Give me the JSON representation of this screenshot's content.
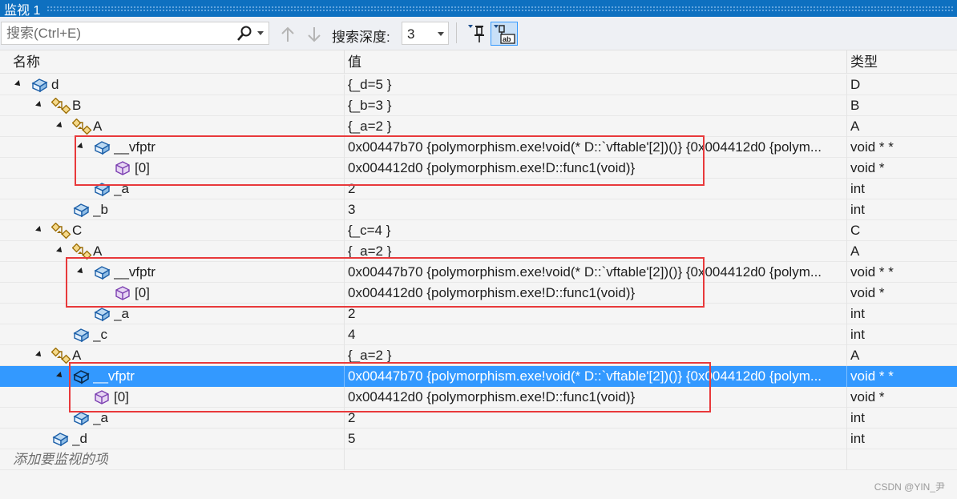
{
  "window": {
    "title": "监视 1"
  },
  "toolbar": {
    "search_placeholder": "搜索(Ctrl+E)",
    "depth_label": "搜索深度:",
    "depth_value": "3"
  },
  "columns": {
    "name": "名称",
    "value": "值",
    "type": "类型"
  },
  "rows": [
    {
      "name": "d",
      "value": "{_d=5 }",
      "type": "D",
      "icon": "object-icon",
      "level": 0,
      "expanded": true
    },
    {
      "name": "B",
      "value": "{_b=3 }",
      "type": "B",
      "icon": "base-class-icon",
      "level": 1,
      "expanded": true
    },
    {
      "name": "A",
      "value": "{_a=2 }",
      "type": "A",
      "icon": "base-class-icon",
      "level": 2,
      "expanded": true
    },
    {
      "name": "__vfptr",
      "value": "0x00447b70 {polymorphism.exe!void(* D::`vftable'[2])()} {0x004412d0 {polym...",
      "type": "void * *",
      "icon": "field-icon",
      "level": 3,
      "expanded": true
    },
    {
      "name": "[0]",
      "value": "0x004412d0 {polymorphism.exe!D::func1(void)}",
      "type": "void *",
      "icon": "element-icon",
      "level": 4
    },
    {
      "name": "_a",
      "value": "2",
      "type": "int",
      "icon": "field-icon",
      "level": 3
    },
    {
      "name": "_b",
      "value": "3",
      "type": "int",
      "icon": "field-icon",
      "level": 2
    },
    {
      "name": "C",
      "value": "{_c=4 }",
      "type": "C",
      "icon": "base-class-icon",
      "level": 1,
      "expanded": true
    },
    {
      "name": "A",
      "value": "{_a=2 }",
      "type": "A",
      "icon": "base-class-icon",
      "level": 2,
      "expanded": true
    },
    {
      "name": "__vfptr",
      "value": "0x00447b70 {polymorphism.exe!void(* D::`vftable'[2])()} {0x004412d0 {polym...",
      "type": "void * *",
      "icon": "field-icon",
      "level": 3,
      "expanded": true
    },
    {
      "name": "[0]",
      "value": "0x004412d0 {polymorphism.exe!D::func1(void)}",
      "type": "void *",
      "icon": "element-icon",
      "level": 4
    },
    {
      "name": "_a",
      "value": "2",
      "type": "int",
      "icon": "field-icon",
      "level": 3
    },
    {
      "name": "_c",
      "value": "4",
      "type": "int",
      "icon": "field-icon",
      "level": 2
    },
    {
      "name": "A",
      "value": "{_a=2 }",
      "type": "A",
      "icon": "base-class-icon",
      "level": 1,
      "expanded": true
    },
    {
      "name": "__vfptr",
      "value": "0x00447b70 {polymorphism.exe!void(* D::`vftable'[2])()} {0x004412d0 {polym...",
      "type": "void * *",
      "icon": "field-icon",
      "level": 2,
      "expanded": true,
      "selected": true
    },
    {
      "name": "[0]",
      "value": "0x004412d0 {polymorphism.exe!D::func1(void)}",
      "type": "void *",
      "icon": "element-icon",
      "level": 3
    },
    {
      "name": "_a",
      "value": "2",
      "type": "int",
      "icon": "field-icon",
      "level": 2
    },
    {
      "name": "_d",
      "value": "5",
      "type": "int",
      "icon": "field-icon",
      "level": 1
    }
  ],
  "add_watch_text": "添加要监视的项",
  "watermark": "CSDN @YIN_尹",
  "colors": {
    "title_bar": "#0e70c0",
    "selection": "#3399ff",
    "highlight_box": "#e8393b"
  }
}
